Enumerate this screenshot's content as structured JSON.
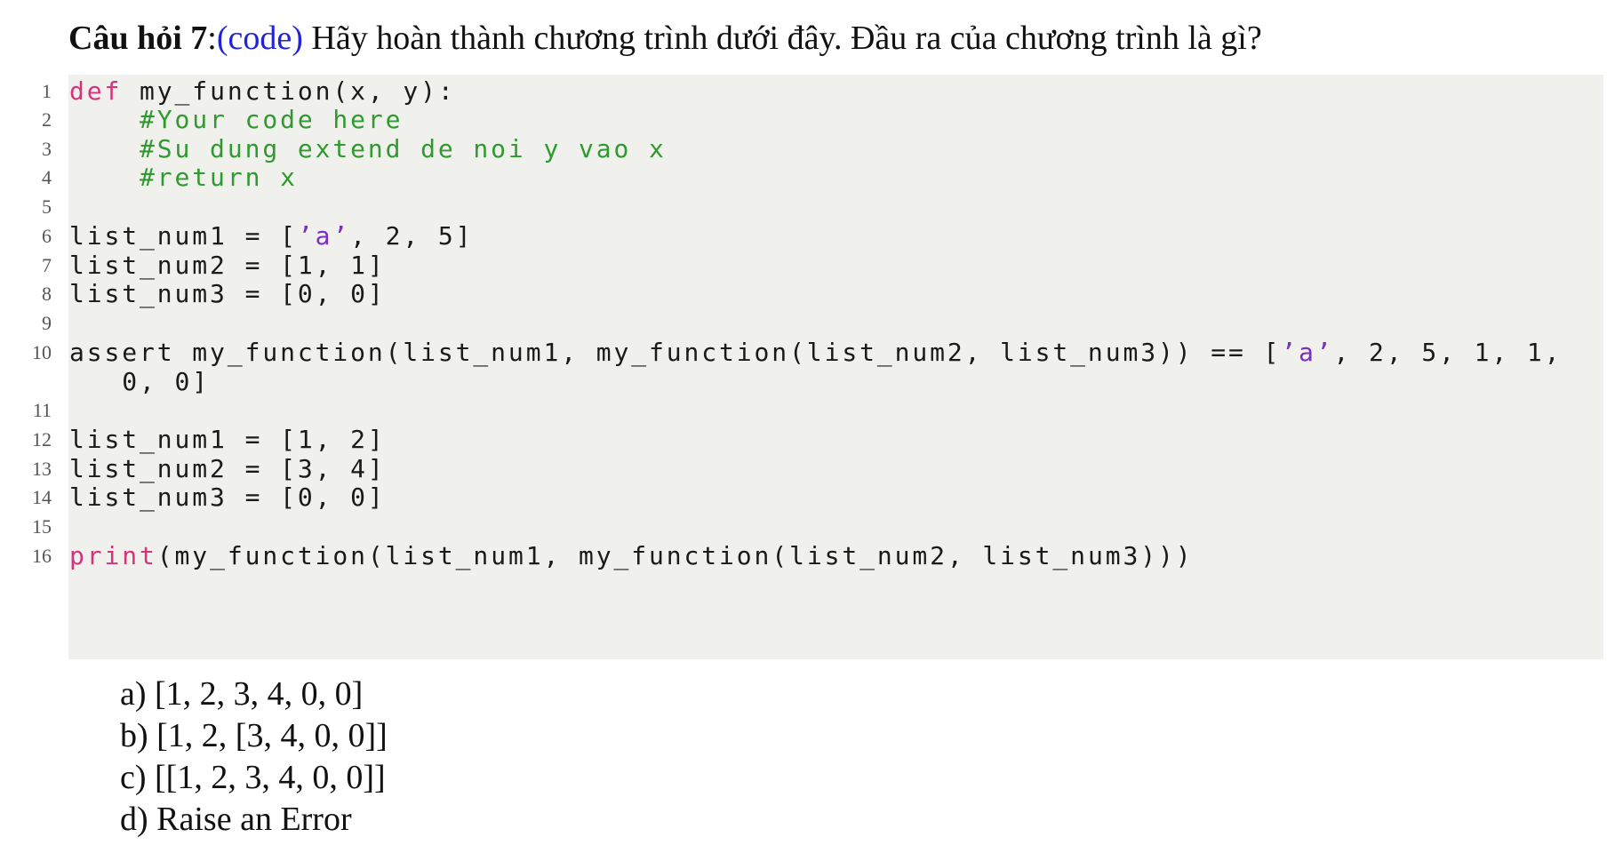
{
  "question": {
    "label": "Câu hỏi 7",
    "colon": ":",
    "tag": "(code)",
    "text": " Hãy hoàn thành chương trình dưới đây. Đầu ra của chương trình là gì?"
  },
  "code": {
    "line_numbers": [
      "1",
      "2",
      "3",
      "4",
      "5",
      "6",
      "7",
      "8",
      "9",
      "10",
      "11",
      "12",
      "13",
      "14",
      "15",
      "16"
    ],
    "lines": {
      "l1_kw": "def",
      "l1_rest": " my_function(x, y):",
      "l2": "    #Your code here",
      "l3": "    #Su dung extend de noi y vao x",
      "l4": "    #return x",
      "l6_a": "list_num1 = [",
      "l6_str": "’a’",
      "l6_b": ", 2, 5]",
      "l7": "list_num2 = [1, 1]",
      "l8": "list_num3 = [0, 0]",
      "l10_a": "assert my_function(list_num1, my_function(list_num2, list_num3)) == [",
      "l10_str": "’a’",
      "l10_b": ", 2, 5, 1, 1,",
      "l10_cont": "   0, 0]",
      "l12": "list_num1 = [1, 2]",
      "l13": "list_num2 = [3, 4]",
      "l14": "list_num3 = [0, 0]",
      "l16_kw": "print",
      "l16_rest": "(my_function(list_num1, my_function(list_num2, list_num3)))"
    }
  },
  "options": [
    "a) [1, 2, 3, 4, 0, 0]",
    "b) [1, 2, [3, 4, 0, 0]]",
    "c) [[1, 2, 3, 4, 0, 0]]",
    "d) Raise an Error"
  ],
  "colors": {
    "keyword": "#d6337e",
    "comment": "#2f9a2f",
    "string": "#7a2fc4",
    "tag": "#2323d6",
    "code_background": "#f0f0ec"
  }
}
